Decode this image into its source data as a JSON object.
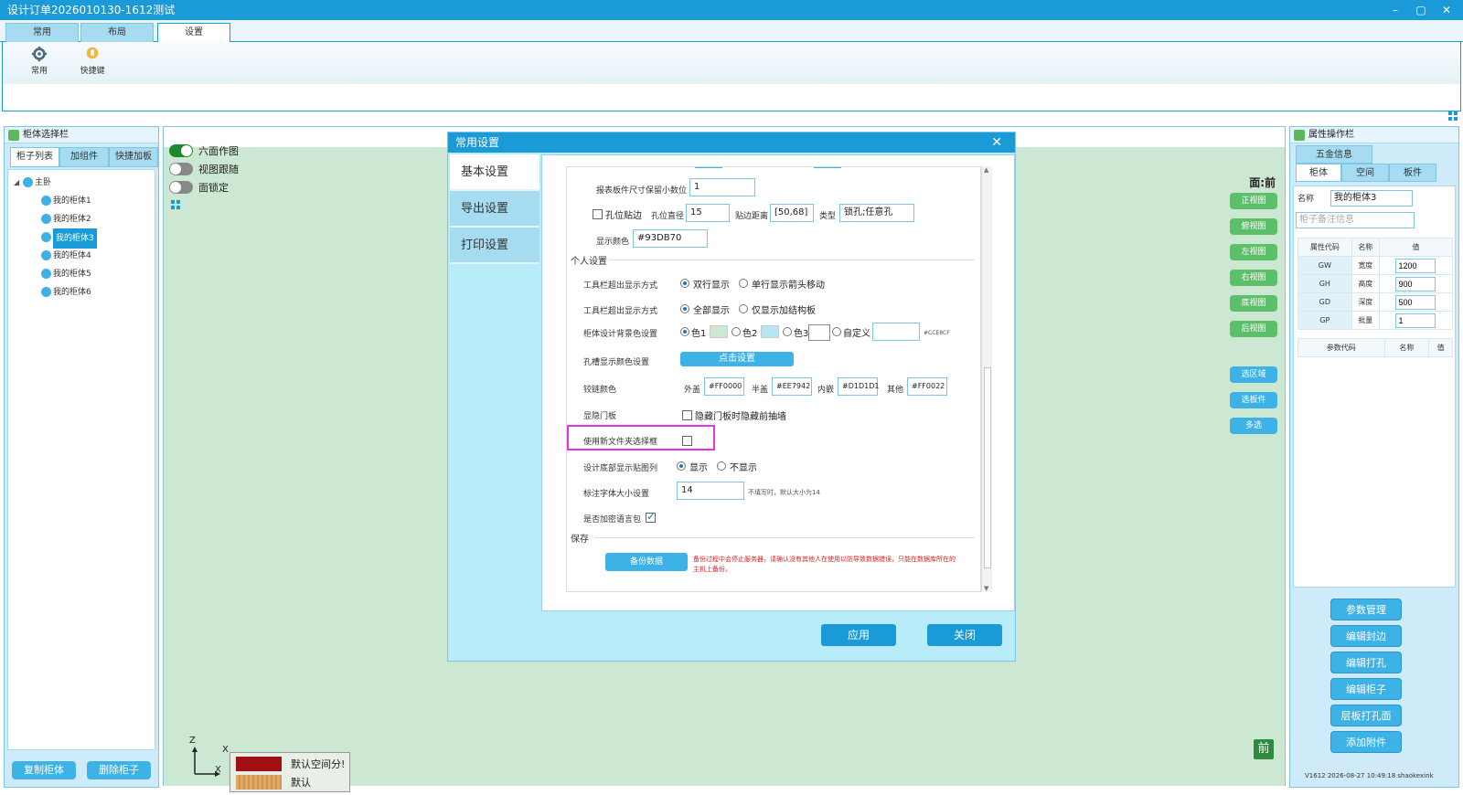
{
  "window": {
    "title": "设计订单2026010130-1612测试",
    "controls": [
      "–",
      "▢",
      "✕"
    ]
  },
  "ribbon": {
    "tabs": [
      "常用",
      "布局",
      "设置"
    ],
    "active_tab": "设置",
    "buttons": [
      {
        "label": "常用",
        "icon": "gear-icon"
      },
      {
        "label": "快捷键",
        "icon": "lightbulb-icon"
      }
    ]
  },
  "left_panel": {
    "title": "柜体选择栏",
    "tabs": [
      "柜子列表",
      "加组件",
      "快捷加板"
    ],
    "tree": {
      "root": "主卧",
      "items": [
        "我的柜体1",
        "我的柜体2",
        "我的柜体3",
        "我的柜体4",
        "我的柜体5",
        "我的柜体6"
      ],
      "selected": "我的柜体3"
    },
    "buttons": {
      "copy": "复制柜体",
      "delete": "删除柜子"
    }
  },
  "canvas": {
    "toggles": [
      {
        "label": "六面作图",
        "on": true
      },
      {
        "label": "视图跟随",
        "on": false
      },
      {
        "label": "面锁定",
        "on": false
      }
    ],
    "face_label": "面:前",
    "view_buttons": [
      "正视图",
      "俯视图",
      "左视图",
      "右视图",
      "底视图",
      "后视图"
    ],
    "select_buttons": [
      "选区域",
      "选板件",
      "多选"
    ],
    "axis": {
      "z": "Z",
      "x": "X",
      "x2": "X"
    },
    "legend": [
      {
        "label": "默认空间分!",
        "color": "#a01010"
      },
      {
        "label": "默认",
        "color": "#e0a866"
      }
    ],
    "front_badge": "前"
  },
  "right_panel": {
    "title": "属性操作栏",
    "top_tab": "五金信息",
    "tabs": [
      "柜体",
      "空间",
      "板件"
    ],
    "name_label": "名称",
    "name_value": "我的柜体3",
    "note_placeholder": "柜子备注信息",
    "table_headers": [
      "属性代码",
      "名称",
      "值"
    ],
    "rows": [
      {
        "code": "GW",
        "name": "宽度",
        "value": "1200"
      },
      {
        "code": "GH",
        "name": "高度",
        "value": "900"
      },
      {
        "code": "GD",
        "name": "深度",
        "value": "500"
      },
      {
        "code": "GP",
        "name": "批量",
        "value": "1"
      }
    ],
    "param_headers": [
      "参数代码",
      "名称",
      "值"
    ],
    "actions": [
      "参数管理",
      "编辑封边",
      "编辑打孔",
      "编辑柜子",
      "层板打孔面",
      "添加附件"
    ],
    "version": "V1612 2026-08-27 10:49:18 shaokexink"
  },
  "dialog": {
    "title": "常用设置",
    "nav": [
      "基本设置",
      "导出设置",
      "打印设置"
    ],
    "active_nav": "基本设置",
    "fields": {
      "decimal_label": "报表板件尺寸保留小数位",
      "decimal_value": "1",
      "hole_edge_label": "孔位贴边",
      "hole_diameter_label": "孔位直径",
      "hole_diameter_value": "15",
      "edge_distance_label": "贴边距离",
      "edge_distance_value": "[50,68]",
      "type_label": "类型",
      "type_value": "锁孔;任意孔",
      "display_color_label": "显示颜色",
      "display_color_value": "#93DB70"
    },
    "personal_section": "个人设置",
    "toolbar_display": {
      "label": "工具栏超出显示方式",
      "options": [
        "双行显示",
        "单行显示箭头移动"
      ],
      "selected": 0
    },
    "toolbar_display2": {
      "label": "工具栏超出显示方式",
      "options": [
        "全部显示",
        "仅显示加结构板"
      ],
      "selected": 0
    },
    "bg_color": {
      "label": "柜体设计背景色设置",
      "options": [
        "色1",
        "色2",
        "色3",
        "自定义"
      ],
      "selected": 0,
      "swatches": [
        "#cde8d2",
        "#b8e6f0",
        "#ffffff"
      ],
      "custom_hint": "#CCE8CF"
    },
    "slot_color": {
      "label": "孔槽显示颜色设置",
      "button": "点击设置"
    },
    "hinge_color": {
      "label": "铰链颜色",
      "outer_label": "外盖",
      "outer_value": "#FF0000",
      "half_label": "半盖",
      "half_value": "#EE7942",
      "inner_label": "内嵌",
      "inner_value": "#D1D1D1",
      "other_label": "其他",
      "other_value": "#FF0022"
    },
    "hide_door": {
      "label": "显隐门板",
      "checkbox_label": "隐藏门板时隐藏前抽墙"
    },
    "new_file_dialog": {
      "label": "使用新文件夹选择框"
    },
    "bottom_chart": {
      "label": "设计底部显示贴图列",
      "options": [
        "显示",
        "不显示"
      ],
      "selected": 0
    },
    "font_size": {
      "label": "标注字体大小设置",
      "value": "14",
      "hint": "不填写时，默认大小为14"
    },
    "encrypt": {
      "label": "是否加密语言包",
      "checked": true
    },
    "save_section": "保存",
    "backup_button": "备份数据",
    "backup_warning": "备份过程中会停止服务器，请确认没有其他人在使用以防导致数据错误，只能在数据库所在的主机上备份。",
    "apply_button": "应用",
    "close_button": "关闭"
  },
  "colors": {
    "accent": "#1a9ad6",
    "canvas_bg": "#cde8d2",
    "panel_bg": "#cfeaf8",
    "dialog_bg": "#b8ecf8",
    "highlight": "#e233e6"
  }
}
